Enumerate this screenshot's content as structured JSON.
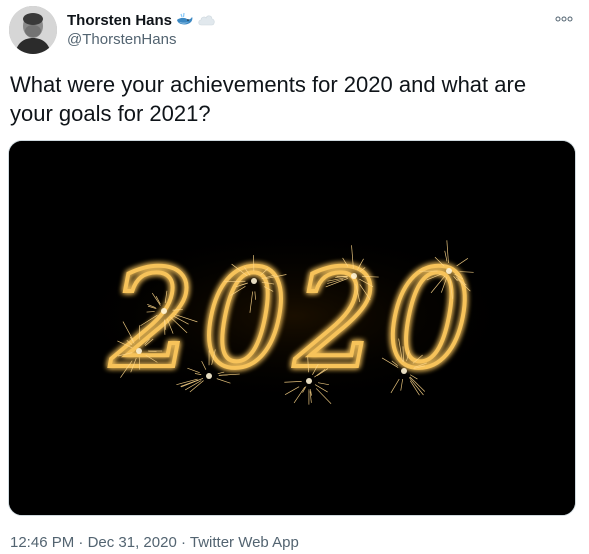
{
  "author": {
    "display_name": "Thorsten Hans",
    "handle": "@ThorstenHans",
    "name_emojis": [
      "whale-emoji",
      "cloud-emoji"
    ],
    "avatar": "profile-photo"
  },
  "tweet": {
    "text": "What were your achievements for 2020 and what are your goals for 2021?",
    "media": {
      "type": "photo",
      "alt_subject": "sparkler-2020",
      "sparkler_text": "2020",
      "background_color": "#000000",
      "sparkle_color": "#f7c35a"
    },
    "time": "12:46 PM",
    "separator_1": " · ",
    "date": "Dec 31, 2020",
    "separator_2": " · ",
    "source": "Twitter Web App"
  },
  "actions": {
    "more_icon": "more-options-icon"
  },
  "colors": {
    "text_primary": "#0f1419",
    "text_secondary": "#536471",
    "media_border": "#cfd9de"
  }
}
